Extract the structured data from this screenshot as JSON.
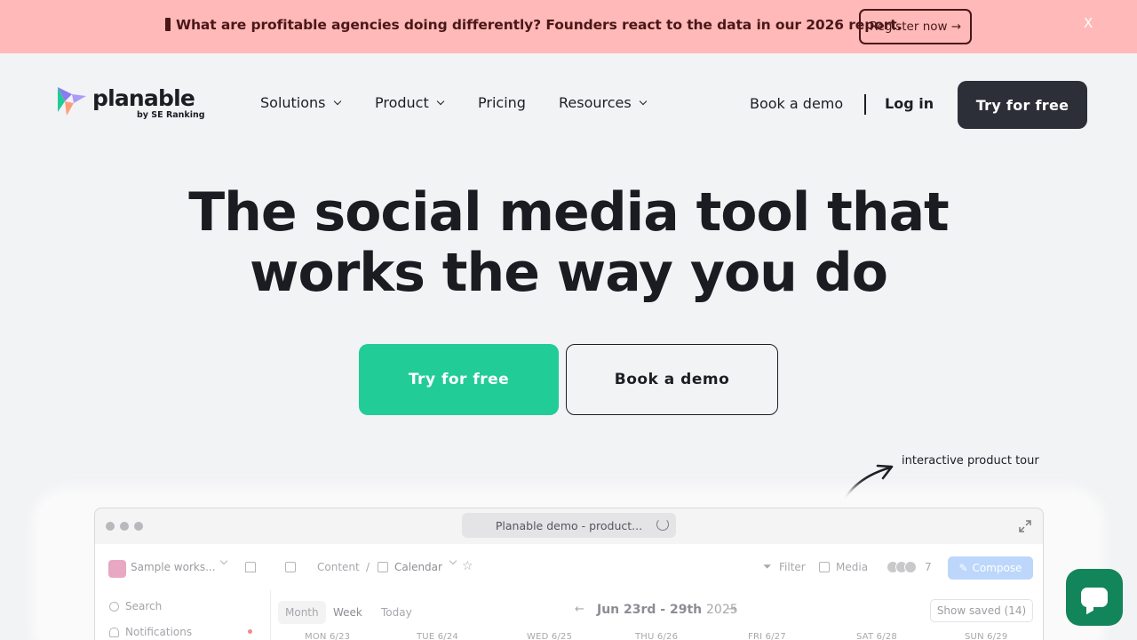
{
  "banner": {
    "text": "What are profitable agencies doing differently? Founders react to the data in our 2026 report.",
    "cta": "Register now →",
    "close": "X",
    "bg_color": "#ffb9b9"
  },
  "header": {
    "logo_word": "planable",
    "logo_sub": "by SE Ranking",
    "nav": [
      {
        "label": "Solutions",
        "has_dropdown": true
      },
      {
        "label": "Product",
        "has_dropdown": true
      },
      {
        "label": "Pricing",
        "has_dropdown": false
      },
      {
        "label": "Resources",
        "has_dropdown": true
      }
    ],
    "book_demo": "Book a demo",
    "login": "Log in",
    "cta": "Try for free"
  },
  "hero": {
    "title_line1": "The social media tool that",
    "title_line2": "works the way you do",
    "primary_cta": "Try for free",
    "secondary_cta": "Book a demo",
    "accent_color": "#22cc96"
  },
  "tour": {
    "label": "interactive product tour"
  },
  "demo": {
    "url_title": "Planable demo - product...",
    "workspace": "Sample works...",
    "breadcrumb_content": "Content",
    "breadcrumb_calendar": "Calendar",
    "filter": "Filter",
    "media": "Media",
    "avatar_count": "7",
    "compose": "Compose",
    "sidebar": [
      {
        "label": "Search",
        "icon": "search-icon"
      },
      {
        "label": "Notifications",
        "icon": "bell-icon"
      }
    ],
    "view_tabs": [
      "Month",
      "Week",
      "Today"
    ],
    "week_range": "Jun 23rd - 29th",
    "year": "2025",
    "show_saved": "Show saved (14)",
    "days": [
      "MON 6/23",
      "TUE 6/24",
      "WED 6/25",
      "THU 6/26",
      "FRI 6/27",
      "SAT 6/28",
      "SUN 6/29"
    ]
  },
  "chat": {
    "icon": "chat-bubble-icon",
    "color": "#13855a"
  }
}
